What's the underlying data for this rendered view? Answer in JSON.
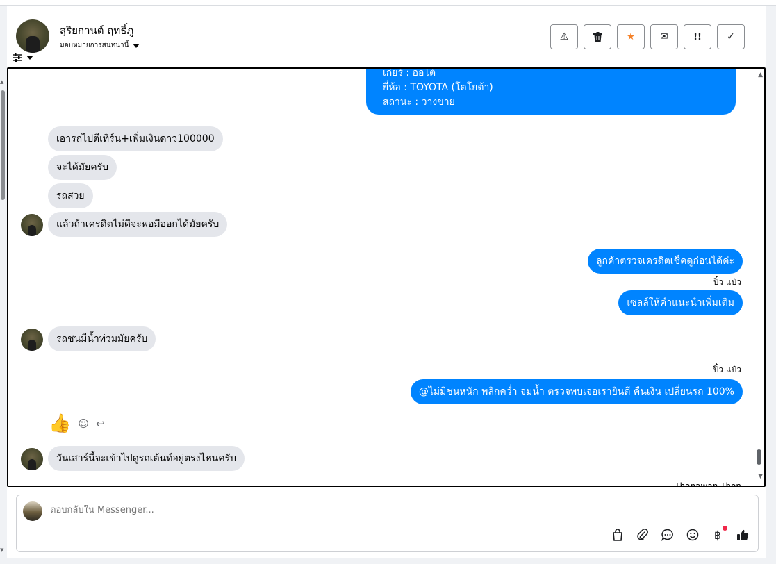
{
  "header": {
    "name": "สุริยกานต์ ฤทธิ์ภู",
    "subtitle": "มอบหมายการสนทนานี้",
    "actions": [
      {
        "icon": "warning-icon",
        "glyph": "⚠"
      },
      {
        "icon": "trash-icon",
        "glyph": "🗑"
      },
      {
        "icon": "star-icon",
        "glyph": "★"
      },
      {
        "icon": "envelope-icon",
        "glyph": "✉"
      },
      {
        "icon": "important-icon",
        "glyph": "!!"
      },
      {
        "icon": "check-icon",
        "glyph": "✓"
      }
    ]
  },
  "chat": {
    "card_lines": [
      "เกียร์ : ออโต้",
      "ยี่ห้อ : TOYOTA (โตโยต้า)",
      "สถานะ : วางขาย"
    ],
    "messages": [
      {
        "side": "in",
        "text": "เอารถไปตีเทิร์น+เพิ่มเงินดาว100000"
      },
      {
        "side": "in",
        "text": "จะได้มัยครับ"
      },
      {
        "side": "in",
        "text": "รถสวย"
      },
      {
        "side": "in",
        "text": "แล้วถ้าเครดิตไม่ดีจะพอมีออกได้มัยครับ"
      },
      {
        "side": "out",
        "text": "ลูกค้าตรวจเครดิตเช็คดูก่อนได้ค่ะ"
      },
      {
        "side": "out",
        "text": "เซลล์ให้คำแนะนำเพิ่มเติม"
      },
      {
        "side": "in",
        "text": "รถชนมีน้ำท่วมมัยครับ"
      },
      {
        "side": "out",
        "text": "@ไม่มีชนหนัก พลิกคว่ำ จมน้ำ ตรวจพบเจอเรายินดี คืนเงิน เปลี่ยนรถ 100%"
      },
      {
        "side": "in",
        "text": "วันเสาร์นี้จะเข้าไปดูรถเต้นท์อยู่ตรงไหนครับ"
      }
    ],
    "sender_label": "ปิ๋ว แป๋ว",
    "cutoff_label": "Thanawan Thon"
  },
  "composer": {
    "placeholder": "ตอบกลับใน Messenger...",
    "tools": [
      "bag-icon",
      "paperclip-icon",
      "chat-bubble-icon",
      "smiley-icon",
      "baht-icon",
      "thumbs-up-icon"
    ]
  }
}
